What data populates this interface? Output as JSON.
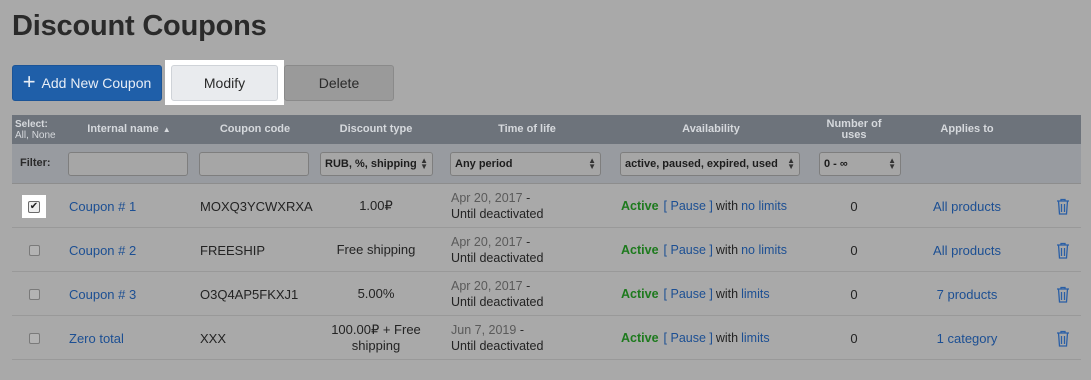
{
  "page_title": "Discount Coupons",
  "toolbar": {
    "add_label": "Add New Coupon",
    "modify_label": "Modify",
    "delete_label": "Delete"
  },
  "columns": {
    "select_title": "Select:",
    "select_all": "All",
    "select_none": "None",
    "internal_name": "Internal name",
    "coupon_code": "Coupon code",
    "discount_type": "Discount type",
    "time_of_life": "Time of life",
    "availability": "Availability",
    "number_of_uses_1": "Number of",
    "number_of_uses_2": "uses",
    "applies_to": "Applies to"
  },
  "filter": {
    "label": "Filter:",
    "discount_type": "RUB, %, shipping",
    "time_of_life": "Any period",
    "availability": "active, paused, expired, used",
    "uses": "0 - ∞"
  },
  "rows": [
    {
      "checked": true,
      "name": "Coupon # 1",
      "code": "MOXQ3YCWXRXA",
      "discount": "1.00₽",
      "discount_line2": "",
      "date": "Apr 20, 2017",
      "dash": " -",
      "until": "Until deactivated",
      "status": "Active",
      "pause": "[ Pause ]",
      "with": "with",
      "limit": "no limits",
      "uses": "0",
      "applies": "All products"
    },
    {
      "checked": false,
      "name": "Coupon # 2",
      "code": "FREESHIP",
      "discount": "Free shipping",
      "discount_line2": "",
      "date": "Apr 20, 2017",
      "dash": " -",
      "until": "Until deactivated",
      "status": "Active",
      "pause": "[ Pause ]",
      "with": "with",
      "limit": "no limits",
      "uses": "0",
      "applies": "All products"
    },
    {
      "checked": false,
      "name": "Coupon # 3",
      "code": "O3Q4AP5FKXJ1",
      "discount": "5.00%",
      "discount_line2": "",
      "date": "Apr 20, 2017",
      "dash": " -",
      "until": "Until deactivated",
      "status": "Active",
      "pause": "[ Pause ]",
      "with": "with",
      "limit": "limits",
      "uses": "0",
      "applies": "7 products"
    },
    {
      "checked": false,
      "name": "Zero total",
      "code": "XXX",
      "discount": "100.00₽ + Free",
      "discount_line2": "shipping",
      "date": "Jun 7, 2019",
      "dash": " -",
      "until": "Until deactivated",
      "status": "Active",
      "pause": "[ Pause ]",
      "with": "with",
      "limit": "limits",
      "uses": "0",
      "applies": "1 category"
    }
  ],
  "icons": {
    "add": "plus-icon",
    "sort": "sort-ascending-icon",
    "dropdown": "dropdown-caret-icon",
    "delete_row": "trash-icon"
  },
  "colors": {
    "primary": "#1f5fa9",
    "active_status": "#1d7a1d",
    "link": "#1c4f93",
    "header_bg": "#6d737b"
  }
}
